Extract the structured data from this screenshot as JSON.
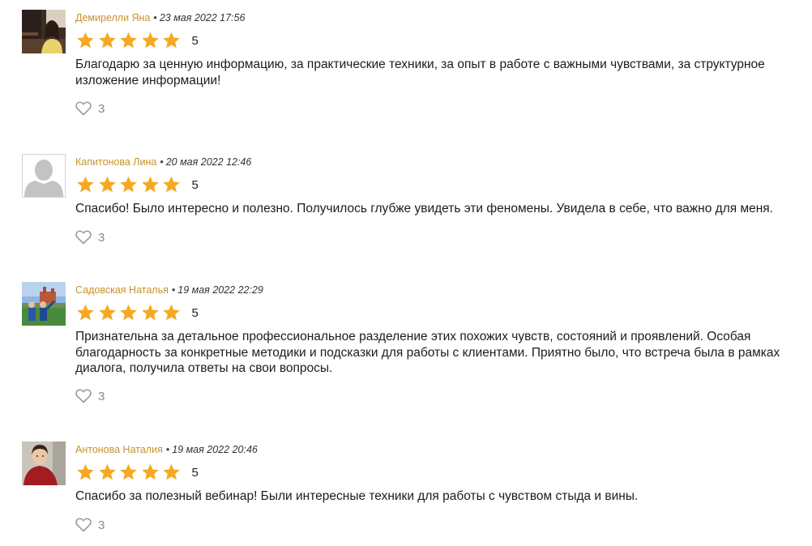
{
  "reviews": [
    {
      "author": "Демирелли Яна",
      "separator": "•",
      "date": "23 мая 2022 17:56",
      "rating": 5,
      "rating_label": "5",
      "text": "Благодарю за ценную информацию, за практические техники, за опыт в работе с важными чувствами, за структурное изложение информации!",
      "likes": "3",
      "avatar": "photo"
    },
    {
      "author": "Капитонова Лина",
      "separator": "•",
      "date": "20 мая 2022 12:46",
      "rating": 5,
      "rating_label": "5",
      "text": "Спасибо! Было интересно и полезно. Получилось глубже увидеть эти феномены. Увидела в себе, что важно для меня.",
      "likes": "3",
      "avatar": "placeholder"
    },
    {
      "author": "Садовская Наталья",
      "separator": "•",
      "date": "19 мая 2022 22:29",
      "rating": 5,
      "rating_label": "5",
      "text": "Признательна за детальное профессиональное разделение этих похожих чувств, состояний и проявлений. Особая благодарность за конкретные методики и подсказки для работы с клиентами. Приятно было, что встреча была в рамках диалога, получила ответы на свои вопросы.",
      "likes": "3",
      "avatar": "photo"
    },
    {
      "author": "Антонова Наталия",
      "separator": "•",
      "date": "19 мая 2022 20:46",
      "rating": 5,
      "rating_label": "5",
      "text": "Спасибо за полезный вебинар! Были интересные техники для работы с чувством стыда и вины.",
      "likes": "3",
      "avatar": "photo"
    }
  ],
  "icons": {
    "star": "star-icon",
    "like": "heart-icon"
  },
  "colors": {
    "author": "#c8922e",
    "star": "#f7a823",
    "like": "#9a9a9a",
    "likes_count": "#8a8a8a"
  }
}
